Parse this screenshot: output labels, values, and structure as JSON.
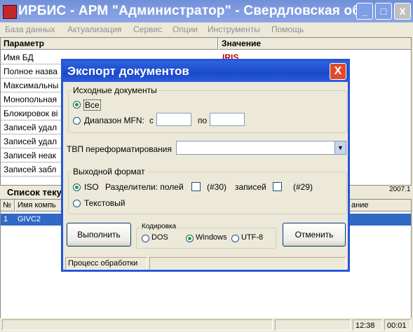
{
  "window": {
    "title": "ИРБИС - АРМ \"Администратор\" - Свердловская об...",
    "minimize": "_",
    "maximize": "□",
    "close": "X"
  },
  "menu": [
    "База данных",
    "Актуализация",
    "Сервис",
    "Опции",
    "Инструменты",
    "Помощь"
  ],
  "grid": {
    "col_param": "Параметр",
    "col_value": "Значение",
    "rows": [
      "Имя БД",
      "Полное назва",
      "Максимальны",
      "Монопольная",
      "Блокировок ві",
      "Записей удал",
      "Записей удал",
      "Записей неак",
      "Записей забл"
    ],
    "first_value": "IRIS"
  },
  "list": {
    "title": "Список теку",
    "version": "2007.1",
    "col_no": "№",
    "col_name": "Имя компь",
    "col_last": "ание",
    "row_no": "1",
    "row_name": "GIVC2"
  },
  "statusbar": {
    "time1": "12:38",
    "time2": "00:01"
  },
  "dialog": {
    "title": "Экспорт документов",
    "close": "X",
    "source_group": "Исходные документы",
    "opt_all": "Все",
    "opt_range": "Диапазон MFN:",
    "from_label": "с",
    "to_label": "по",
    "from_value": "",
    "to_value": "",
    "tvp_label": "ТВП переформатирования",
    "tvp_value": "",
    "output_group": "Выходной формат",
    "opt_iso": "ISO",
    "separators_label": "Разделители: полей",
    "field_sep_code": "(#30)",
    "records_label": "записей",
    "record_sep_code": "(#29)",
    "opt_text": "Текстовый",
    "run_button": "Выполнить",
    "encoding_group": "Кодировка",
    "enc_dos": "DOS",
    "enc_windows": "Windows",
    "enc_utf8": "UTF-8",
    "cancel_button": "Отменить",
    "status": "Процесс обработки"
  }
}
